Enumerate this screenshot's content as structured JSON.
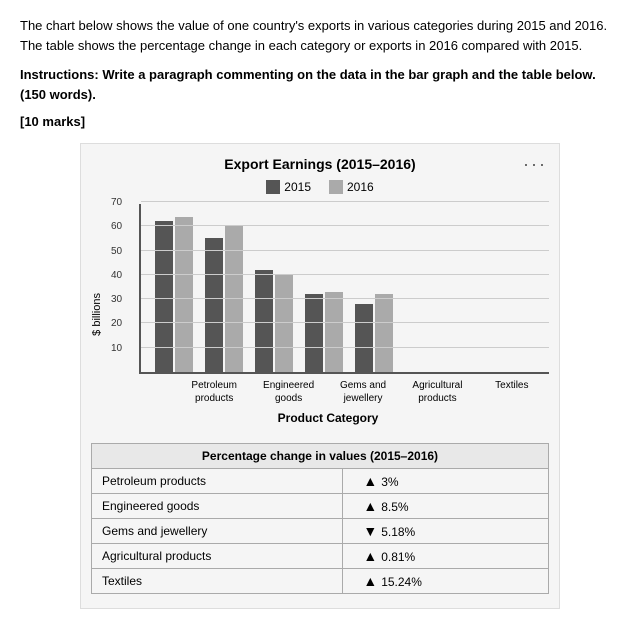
{
  "intro": {
    "line1": "The chart below shows the value of one country's exports in various categories during 2015 and 2016. The table shows the percentage change in each category or exports in 2016 compared with 2015.",
    "instruction_bold": "Instructions: Write a paragraph commenting on the data in the bar graph and the table below. (150 words).",
    "marks": "[10 marks]"
  },
  "chart": {
    "title": "Export Earnings (2015–2016)",
    "legend": {
      "label_2015": "2015",
      "label_2016": "2016"
    },
    "y_axis_label": "$ billions",
    "y_ticks": [
      "70",
      "60",
      "50",
      "40",
      "30",
      "20",
      "10"
    ],
    "x_axis_title": "Product Category",
    "categories": [
      {
        "label": "Petroleum\nproducts",
        "val_2015": 62,
        "val_2016": 64
      },
      {
        "label": "Engineered\ngoods",
        "val_2015": 55,
        "val_2016": 60
      },
      {
        "label": "Gems and\njewellery",
        "val_2015": 42,
        "val_2016": 40
      },
      {
        "label": "Agricultural\nproducts",
        "val_2015": 32,
        "val_2016": 33
      },
      {
        "label": "Textiles",
        "val_2015": 28,
        "val_2016": 32
      }
    ],
    "three_dots": "···"
  },
  "table": {
    "header": "Percentage change in values (2015–2016)",
    "rows": [
      {
        "category": "Petroleum products",
        "direction": "up",
        "value": "3%"
      },
      {
        "category": "Engineered goods",
        "direction": "up",
        "value": "8.5%"
      },
      {
        "category": "Gems and jewellery",
        "direction": "down",
        "value": "5.18%"
      },
      {
        "category": "Agricultural products",
        "direction": "up",
        "value": "0.81%"
      },
      {
        "category": "Textiles",
        "direction": "up",
        "value": "15.24%"
      }
    ]
  }
}
